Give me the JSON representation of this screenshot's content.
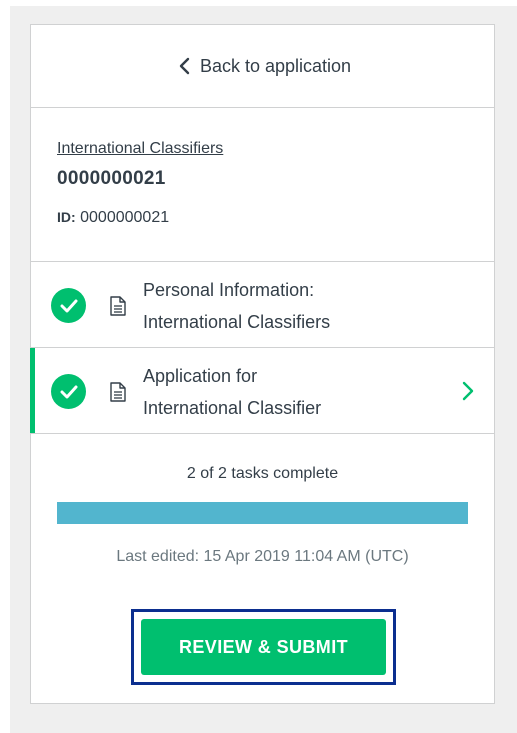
{
  "nav": {
    "back_label": "Back to application"
  },
  "application": {
    "org_link": "International Classifiers",
    "number": "0000000021",
    "id_label": "ID:",
    "id_value": "0000000021"
  },
  "tasks": [
    {
      "line1": "Personal Information:",
      "line2": "International Classifiers",
      "status": "complete",
      "icon": "check-circle-icon"
    },
    {
      "line1": "Application for",
      "line2": "International Classifier",
      "status": "complete",
      "icon": "check-circle-icon",
      "active": true
    }
  ],
  "progress": {
    "summary": "2 of 2 tasks complete",
    "completed": 2,
    "total": 2,
    "percent": 100
  },
  "last_edited": "Last edited: 15 Apr 2019 11:04 AM (UTC)",
  "submit_label": "REVIEW & SUBMIT",
  "colors": {
    "accent_green": "#00bf6f",
    "progress_blue": "#52b5ce",
    "focus_outline": "#0b2e8f",
    "text": "#333e48"
  }
}
